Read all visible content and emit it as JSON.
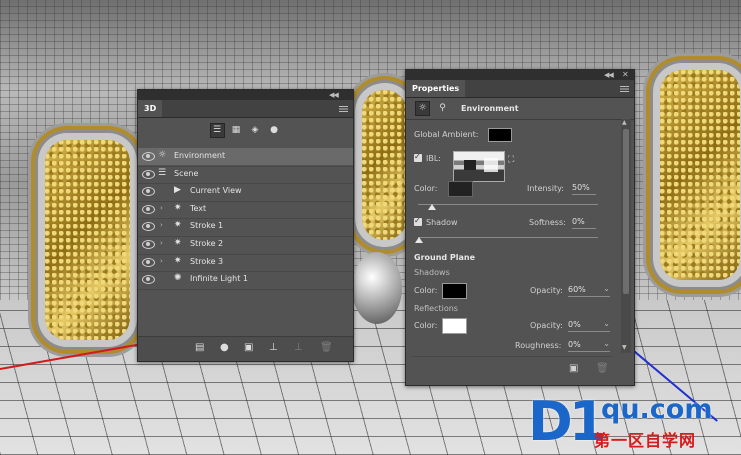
{
  "watermark": {
    "main": "D1",
    "domain": "qu.com",
    "sub": "第一区自学网"
  },
  "panel3d": {
    "title": "3D",
    "toolbar_icons": [
      "scene-filter-icon",
      "mesh-filter-icon",
      "materials-filter-icon",
      "lights-filter-icon"
    ],
    "layers": [
      {
        "label": "Environment",
        "icon": "environment-icon",
        "visible": true,
        "selected": true
      },
      {
        "label": "Scene",
        "icon": "scene-icon",
        "visible": true
      },
      {
        "label": "Current View",
        "icon": "camera-icon",
        "visible": true
      },
      {
        "label": "Text",
        "icon": "mesh-icon",
        "visible": true
      },
      {
        "label": "Stroke 1",
        "icon": "mesh-icon",
        "visible": true
      },
      {
        "label": "Stroke 2",
        "icon": "mesh-icon",
        "visible": true
      },
      {
        "label": "Stroke 3",
        "icon": "mesh-icon",
        "visible": true
      },
      {
        "label": "Infinite Light 1",
        "icon": "light-icon",
        "visible": true
      }
    ],
    "bottom_icons": [
      "add-mesh-icon",
      "add-light-icon",
      "render-icon",
      "ground-icon",
      "add-object-icon",
      "trash-icon"
    ]
  },
  "properties": {
    "title": "Properties",
    "section": "Environment",
    "global_ambient_label": "Global Ambient:",
    "global_ambient_color": "#000000",
    "ibl_label": "IBL:",
    "ibl_checked": true,
    "color_label": "Color:",
    "intensity_label": "Intensity:",
    "intensity_value": "50%",
    "shadow_label": "Shadow",
    "shadow_checked": true,
    "softness_label": "Softness:",
    "softness_value": "0%",
    "ground_plane_label": "Ground Plane",
    "shadows_label": "Shadows",
    "shadows_color_label": "Color:",
    "shadows_color": "#000000",
    "shadows_opacity_label": "Opacity:",
    "shadows_opacity_value": "60%",
    "reflections_label": "Reflections",
    "reflections_color_label": "Color:",
    "reflections_color": "#ffffff",
    "reflections_opacity_label": "Opacity:",
    "reflections_opacity_value": "0%",
    "roughness_label": "Roughness:",
    "roughness_value": "0%"
  },
  "colors": {
    "panel_bg": "#535353",
    "title_bg": "#2f2f2f",
    "selected_row": "#6a6a6a",
    "gold": "#c9a53a"
  }
}
